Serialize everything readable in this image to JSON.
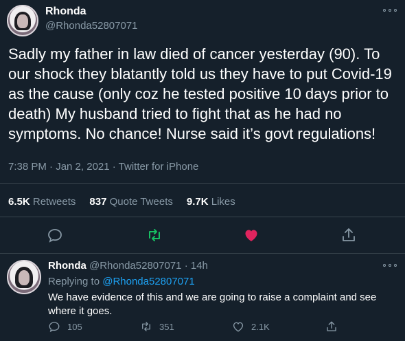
{
  "colors": {
    "background": "#15202b",
    "text": "#ffffff",
    "secondary": "#8899a6",
    "link": "#1da1f2",
    "retweet": "#17bf63",
    "like": "#e0245e",
    "divider": "#38444d"
  },
  "tweet": {
    "author_name": "Rhonda",
    "author_handle": "@Rhonda52807071",
    "text": "Sadly my father in law died of cancer yesterday (90). To our shock they blatantly told us they have to put Covid-19 as the cause (only coz he tested positive 10 days prior to death) My husband tried to fight that as he had no symptoms. No chance! Nurse said it’s govt regulations!",
    "timestamp": "7:38 PM · Jan 2, 2021",
    "separator": " · ",
    "source": "Twitter for iPhone",
    "retweets_count": "6.5K",
    "retweets_label": "Retweets",
    "quote_count": "837",
    "quote_label": "Quote Tweets",
    "likes_count": "9.7K",
    "likes_label": "Likes",
    "icons": [
      "reply-icon",
      "retweet-icon",
      "like-icon",
      "share-icon"
    ]
  },
  "reply": {
    "author_name": "Rhonda",
    "author_handle": "@Rhonda52807071",
    "age": "· 14h",
    "replying_prefix": "Replying to",
    "replying_to": "@Rhonda52807071",
    "text": "We have evidence of this and we are going to raise a complaint and see where it goes.",
    "reply_count": "105",
    "retweet_count": "351",
    "like_count": "2.1K"
  }
}
